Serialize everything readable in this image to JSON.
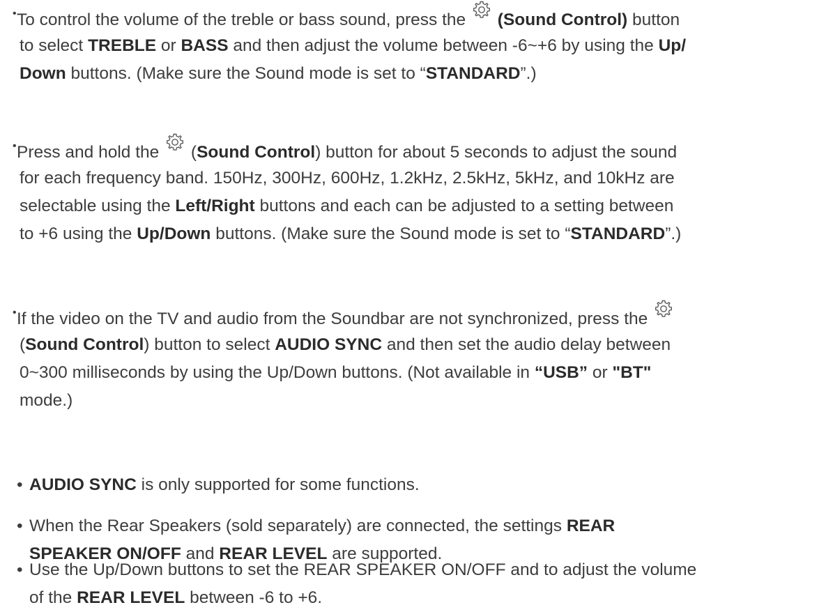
{
  "items": [
    {
      "lines": [
        [
          "To control the volume of the treble or bass sound, press the ",
          {
            "icon": "gear"
          },
          {
            "b": " (Sound Control)"
          },
          " button"
        ],
        [
          "to select ",
          {
            "b": "TREBLE"
          },
          " or ",
          {
            "b": "BASS"
          },
          " and then adjust the volume between -6~+6 by using the ",
          {
            "b": "Up/"
          }
        ],
        [
          {
            "b": "Down"
          },
          " buttons. (Make sure the Sound mode is set to “",
          {
            "b": "STANDARD"
          },
          "”.)"
        ]
      ]
    },
    {
      "lines": [
        [
          "Press and hold the ",
          {
            "icon": "gear"
          },
          " (",
          {
            "b": "Sound Control"
          },
          ") button for about 5 seconds to adjust the sound"
        ],
        [
          "for each frequency band. 150Hz, 300Hz, 600Hz, 1.2kHz, 2.5kHz, 5kHz, and 10kHz are"
        ],
        [
          "selectable using the ",
          {
            "b": "Left/Right"
          },
          " buttons and each can be adjusted to a setting between"
        ],
        [
          "to +6 using the ",
          {
            "b": "Up/Down"
          },
          " buttons. (Make sure the Sound mode is set to “",
          {
            "b": "STANDARD"
          },
          "”.)"
        ]
      ]
    },
    {
      "lines": [
        [
          "If the video on the TV and audio from the Soundbar are not synchronized, press the ",
          {
            "icon": "gear"
          }
        ],
        [
          "(",
          {
            "b": "Sound Control"
          },
          ") button to select ",
          {
            "b": "AUDIO SYNC"
          },
          " and then set the audio delay between"
        ],
        [
          "0~300 milliseconds by using the Up/Down buttons. (Not available in ",
          {
            "b": "“USB”"
          },
          " or ",
          {
            "b": "\"BT\""
          }
        ],
        [
          "mode.)"
        ]
      ]
    },
    {
      "lines": [
        [
          {
            "b": "AUDIO SYNC"
          },
          " is only supported for some functions."
        ]
      ]
    },
    {
      "lines": [
        [
          "When the Rear Speakers (sold separately) are connected, the settings ",
          {
            "b": "REAR"
          }
        ],
        [
          {
            "b": "SPEAKER ON/OFF"
          },
          " and ",
          {
            "b": "REAR LEVEL"
          },
          " are supported."
        ]
      ]
    },
    {
      "lines": [
        [
          "Use the Up/Down buttons to set the REAR SPEAKER ON/OFF and to adjust the volume"
        ],
        [
          "of the ",
          {
            "b": "REAR LEVEL"
          },
          " between -6 to +6."
        ]
      ]
    }
  ],
  "bullet_char": "•",
  "icon_names": {
    "gear": "gear-icon"
  }
}
